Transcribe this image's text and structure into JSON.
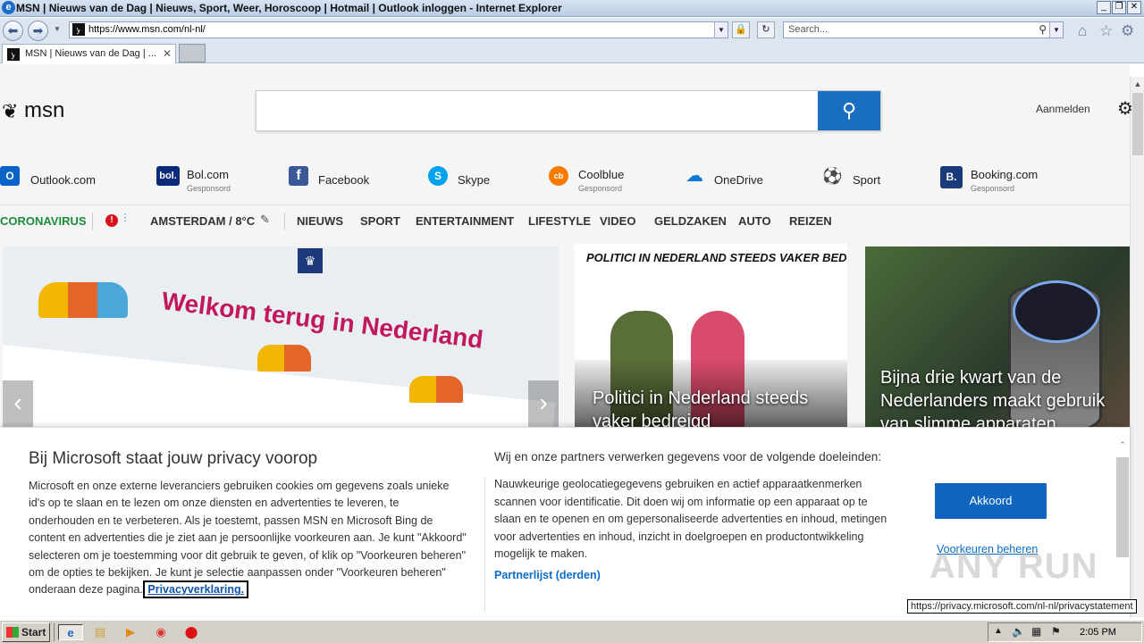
{
  "window": {
    "title": "MSN | Nieuws van de Dag | Nieuws, Sport, Weer, Horoscoop | Hotmail | Outlook inloggen - Internet Explorer",
    "controls": [
      "_",
      "❐",
      "✕"
    ]
  },
  "address_bar": {
    "url": "https://www.msn.com/nl-nl/",
    "search_placeholder": "Search..."
  },
  "tabs": [
    {
      "label": "MSN | Nieuws van de Dag | ...",
      "close": "✕"
    }
  ],
  "msn": {
    "logo_text": "msn",
    "signin": "Aanmelden"
  },
  "quick_links": [
    {
      "name": "Outlook.com",
      "sponsored": "",
      "icon": "outlook-icon",
      "color": "#0a64c8",
      "glyph": "O"
    },
    {
      "name": "Bol.com",
      "sponsored": "Gesponsord",
      "icon": "bol-icon",
      "color": "#0b2a7a",
      "glyph": "bol."
    },
    {
      "name": "Facebook",
      "sponsored": "",
      "icon": "facebook-icon",
      "color": "#3b5998",
      "glyph": "f"
    },
    {
      "name": "Skype",
      "sponsored": "",
      "icon": "skype-icon",
      "color": "#00a2ed",
      "glyph": "S"
    },
    {
      "name": "Coolblue",
      "sponsored": "Gesponsord",
      "icon": "coolblue-icon",
      "color": "#f57c00",
      "glyph": "cb"
    },
    {
      "name": "OneDrive",
      "sponsored": "",
      "icon": "onedrive-icon",
      "color": "#0a78d4",
      "glyph": "☁"
    },
    {
      "name": "Sport",
      "sponsored": "",
      "icon": "sport-icon",
      "color": "#2e3c7a",
      "glyph": "⚽"
    },
    {
      "name": "Booking.com",
      "sponsored": "Gesponsord",
      "icon": "booking-icon",
      "color": "#1b3a7a",
      "glyph": "B."
    }
  ],
  "nav": {
    "coronavirus": "CORONAVIRUS",
    "weather": "AMSTERDAM / 8°C",
    "items": [
      "NIEUWS",
      "SPORT",
      "ENTERTAINMENT",
      "LIFESTYLE",
      "VIDEO",
      "GELDZAKEN",
      "AUTO",
      "REIZEN"
    ]
  },
  "hero": {
    "card1_heading": "Welkom terug in Nederland",
    "card2_caption": "POLITICI IN NEDERLAND STEEDS VAKER BEDREIGD...",
    "card2_title": "Politici in Nederland steeds vaker bedreigd",
    "card3_title": "Bijna drie kwart van de Nederlanders maakt gebruik van slimme apparaten"
  },
  "privacy": {
    "heading": "Bij Microsoft staat jouw privacy voorop",
    "body": "Microsoft en onze externe leveranciers gebruiken cookies om gegevens zoals unieke id's op te slaan en te lezen om onze diensten en advertenties te leveren, te onderhouden en te verbeteren. Als je toestemt, passen MSN en Microsoft Bing de content en advertenties die je ziet aan je persoonlijke voorkeuren aan. Je kunt \"Akkoord\" selecteren om je toestemming voor dit gebruik te geven, of klik op \"Voorkeuren beheren\" om de opties te bekijken. Je kunt je selectie aanpassen onder \"Voorkeuren beheren\" onderaan deze pagina.",
    "privacy_link": "Privacyverklaring.",
    "purposes_heading": "Wij en onze partners verwerken gegevens voor de volgende doeleinden:",
    "purposes_body": "Nauwkeurige geolocatiegegevens gebruiken en actief apparaatkenmerken scannen voor identificatie. Dit doen wij om informatie op een apparaat op te slaan en te openen en om gepersonaliseerde advertenties en inhoud, metingen voor advertenties en inhoud, inzicht in doelgroepen en productontwikkeling mogelijk te maken.",
    "partner_link": "Partnerlijst (derden)",
    "accept": "Akkoord",
    "manage": "Voorkeuren beheren"
  },
  "status_url": "https://privacy.microsoft.com/nl-nl/privacystatement",
  "watermark": "ANY RUN",
  "taskbar": {
    "start": "Start",
    "clock": "2:05 PM"
  }
}
